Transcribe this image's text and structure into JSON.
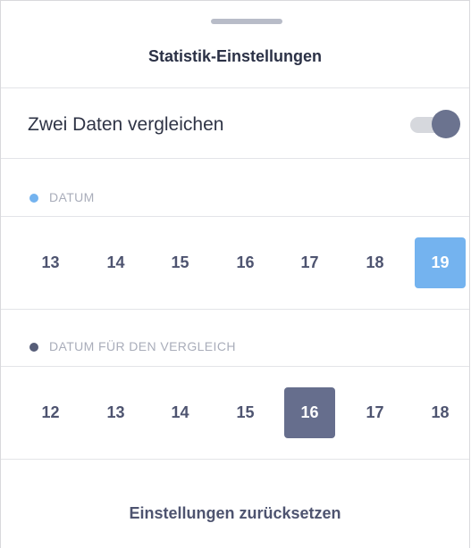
{
  "sheet": {
    "title": "Statistik-Einstellungen"
  },
  "compare_toggle": {
    "label": "Zwei Daten vergleichen",
    "on": true
  },
  "date_section": {
    "label": "DATUM",
    "dot_color": "#74b3ef",
    "days": [
      "13",
      "14",
      "15",
      "16",
      "17",
      "18",
      "19"
    ],
    "selected": "19"
  },
  "compare_section": {
    "label": "DATUM FÜR DEN VERGLEICH",
    "dot_color": "#565d78",
    "days": [
      "12",
      "13",
      "14",
      "15",
      "16",
      "17",
      "18"
    ],
    "selected": "16"
  },
  "footer": {
    "reset_label": "Einstellungen zurücksetzen"
  },
  "colors": {
    "accent_blue": "#74b3ef",
    "accent_dark": "#666e8d",
    "text_dark": "#2b3146"
  }
}
